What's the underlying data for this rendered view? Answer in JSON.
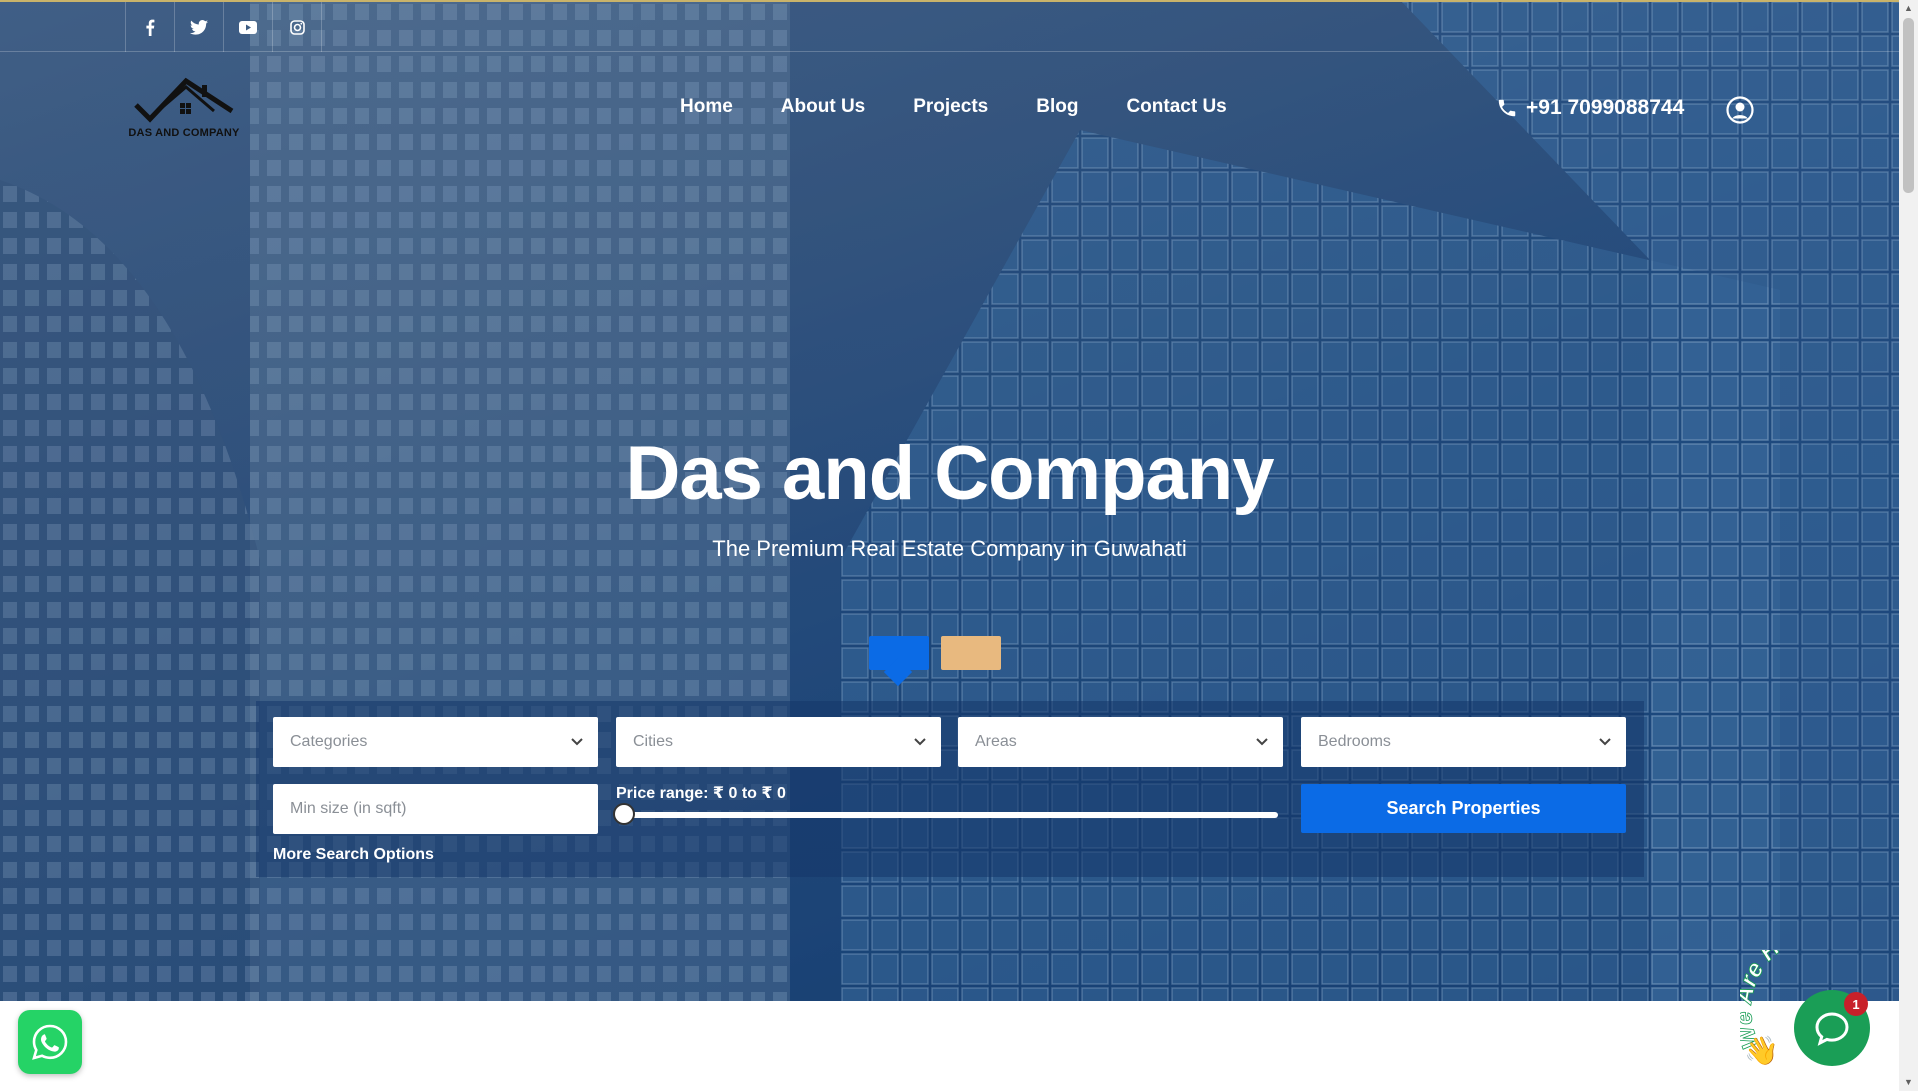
{
  "social": {
    "facebook": "f",
    "twitter": "twitter-icon",
    "youtube": "youtube-icon",
    "instagram": "instagram-icon"
  },
  "logo": {
    "text": "DAS AND COMPANY"
  },
  "nav": {
    "items": [
      "Home",
      "About Us",
      "Projects",
      "Blog",
      "Contact Us"
    ]
  },
  "header": {
    "phone": "+91 7099088744"
  },
  "hero": {
    "title": "Das and Company",
    "subtitle": "The Premium Real Estate Company in Guwahati"
  },
  "search": {
    "categories_placeholder": "Categories",
    "cities_placeholder": "Cities",
    "areas_placeholder": "Areas",
    "bedrooms_placeholder": "Bedrooms",
    "min_size_placeholder": "Min size (in sqft)",
    "price_range_label": "Price range: ₹ 0 to ₹ 0",
    "price_min": 0,
    "price_max": 0,
    "button_label": "Search Properties",
    "more_options": "More Search Options"
  },
  "chat": {
    "badge": "1",
    "banner": "We Are Here!"
  },
  "colors": {
    "accent": "#0b6be6",
    "secondary_tab": "#e8b97f",
    "whatsapp": "#25d366",
    "chat": "#1a9e56"
  }
}
